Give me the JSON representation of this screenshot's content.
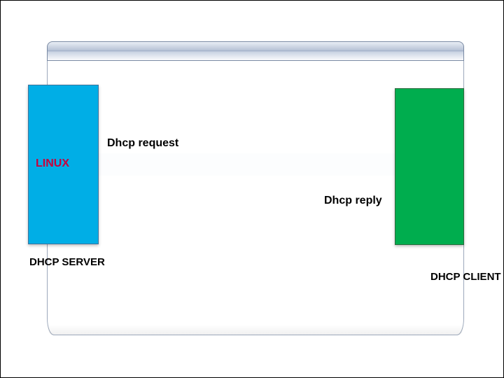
{
  "diagram": {
    "server": {
      "title": "LINUX",
      "caption": "DHCP SERVER",
      "color": "#00aee6"
    },
    "client": {
      "caption": "DHCP CLIENT",
      "color": "#00ad4e"
    },
    "messages": {
      "request": "Dhcp request",
      "reply": "Dhcp reply"
    }
  }
}
